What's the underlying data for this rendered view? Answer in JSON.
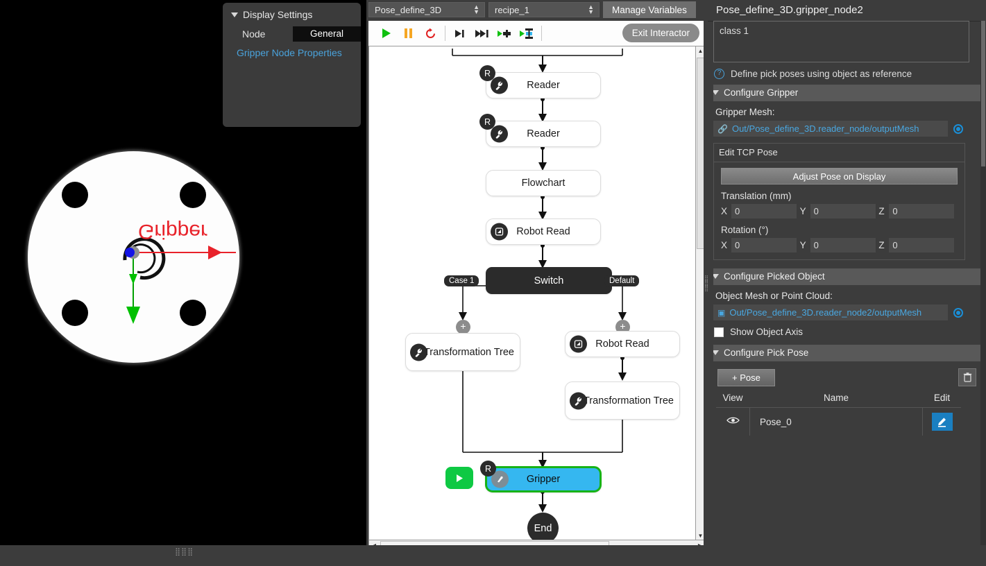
{
  "display_settings": {
    "title": "Display Settings",
    "node_label": "Node",
    "node_value": "General",
    "link": "Gripper Node Properties"
  },
  "viewport": {
    "object_label": "Gripper"
  },
  "center": {
    "project_combo": "Pose_define_3D",
    "recipe_combo": "recipe_1",
    "manage_variables": "Manage Variables",
    "exit_interactor": "Exit Interactor",
    "toolbar_icons": [
      {
        "name": "run-icon",
        "glyph": "▶"
      },
      {
        "name": "pause-icon",
        "glyph": "❚❚"
      },
      {
        "name": "reset-icon",
        "glyph": "↻"
      },
      {
        "name": "step-icon",
        "glyph": "▶|"
      },
      {
        "name": "step-over-icon",
        "glyph": "▶▶|"
      },
      {
        "name": "run-to-node-icon",
        "glyph": "▶●"
      },
      {
        "name": "run-interactor-icon",
        "glyph": "▶▤"
      }
    ],
    "nodes": [
      {
        "id": "reader1",
        "label": "Reader",
        "icon": "wrench-icon",
        "badge": "R",
        "kind": "plain"
      },
      {
        "id": "reader2",
        "label": "Reader",
        "icon": "wrench-icon",
        "badge": "R",
        "kind": "plain"
      },
      {
        "id": "flowchart",
        "label": "Flowchart",
        "icon": "",
        "badge": "",
        "kind": "plain"
      },
      {
        "id": "robotread1",
        "label": "Robot Read",
        "icon": "robot-icon",
        "badge": "",
        "kind": "plain"
      },
      {
        "id": "switch",
        "label": "Switch",
        "icon": "",
        "badge": "",
        "kind": "dark"
      },
      {
        "id": "tftree1",
        "label": "Transformation Tree",
        "icon": "wrench-icon",
        "badge": "",
        "kind": "plain"
      },
      {
        "id": "robotread2",
        "label": "Robot Read",
        "icon": "robot-icon",
        "badge": "",
        "kind": "plain"
      },
      {
        "id": "tftree2",
        "label": "Transformation Tree",
        "icon": "wrench-icon",
        "badge": "",
        "kind": "plain"
      },
      {
        "id": "gripper",
        "label": "Gripper",
        "icon": "gripper-icon",
        "badge": "R",
        "kind": "selected"
      },
      {
        "id": "end",
        "label": "End",
        "icon": "",
        "badge": "",
        "kind": "terminal"
      }
    ],
    "edge_labels": {
      "case1": "Case 1",
      "default": "Default"
    },
    "plus_label": "+"
  },
  "right": {
    "title": "Pose_define_3D.gripper_node2",
    "class_value": "class 1",
    "hint": "Define pick poses using object as reference",
    "sections": {
      "configure_gripper": "Configure Gripper",
      "configure_picked_object": "Configure Picked Object",
      "configure_pick_pose": "Configure Pick Pose"
    },
    "gripper_mesh_label": "Gripper Mesh:",
    "gripper_mesh_value": "Out/Pose_define_3D.reader_node/outputMesh",
    "tcp": {
      "header": "Edit TCP Pose",
      "adjust_button": "Adjust Pose on Display",
      "translation_label": "Translation (mm)",
      "rotation_label": "Rotation (°)",
      "translation": {
        "x": "0",
        "y": "0",
        "z": "0"
      },
      "rotation": {
        "x": "0",
        "y": "0",
        "z": "0"
      },
      "keys": {
        "x": "X",
        "y": "Y",
        "z": "Z"
      }
    },
    "object_mesh_label": "Object Mesh or Point Cloud:",
    "object_mesh_value": "Out/Pose_define_3D.reader_node2/outputMesh",
    "show_object_axis": "Show Object Axis",
    "pose": {
      "add_button": "+ Pose",
      "columns": {
        "view": "View",
        "name": "Name",
        "edit": "Edit"
      },
      "rows": [
        {
          "name": "Pose_0"
        }
      ]
    }
  },
  "colors": {
    "accent_blue": "#35b7f0",
    "selection_green": "#16b316",
    "link_blue": "#49a7e0",
    "panel_bg": "#3c3c3c",
    "section_hdr": "#595959",
    "edit_blue": "#1a7fc1",
    "axis_red": "#e8222a",
    "axis_green": "#00b400",
    "axis_blue": "#1414e6"
  }
}
